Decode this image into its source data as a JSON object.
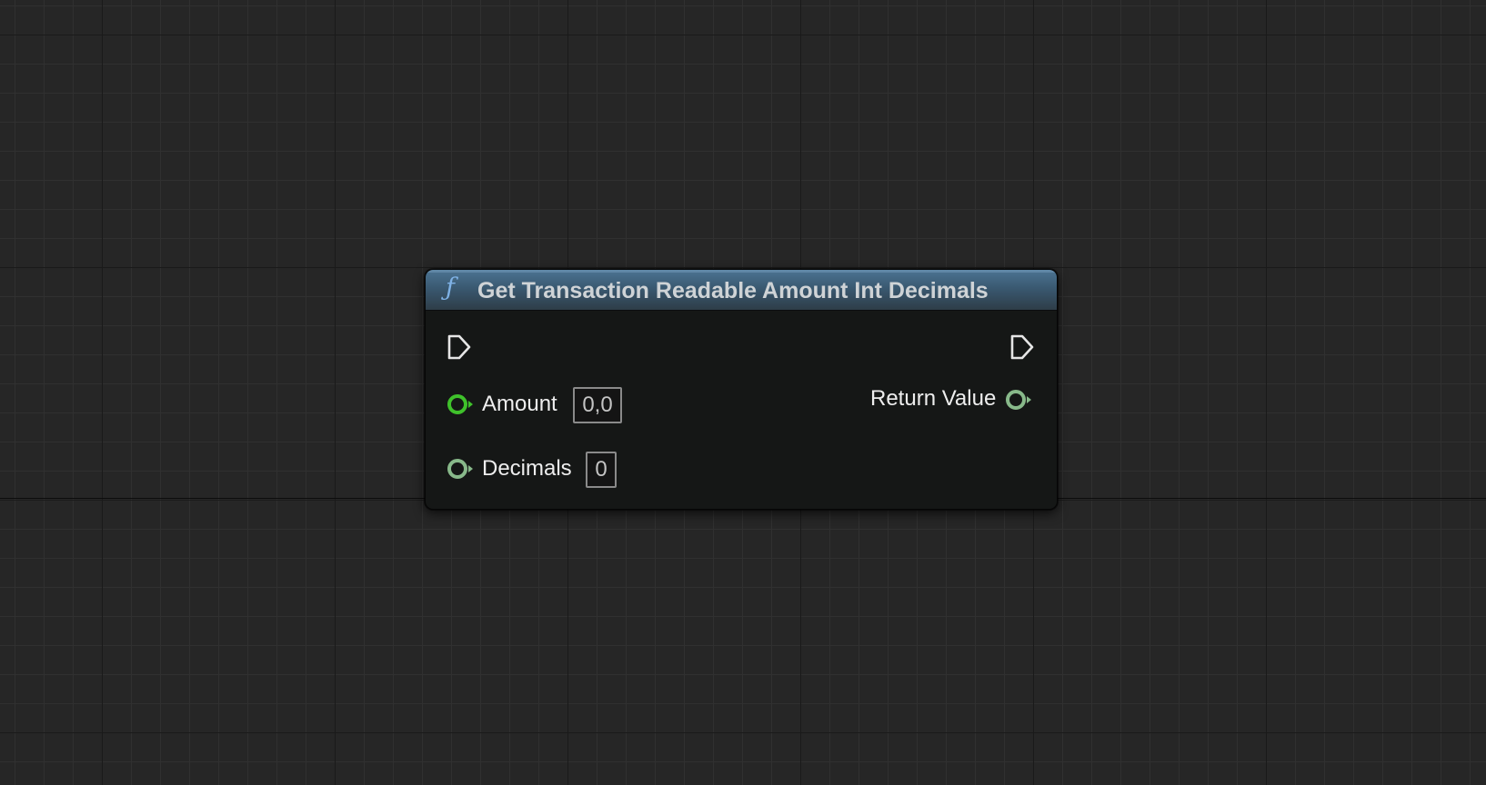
{
  "node": {
    "title": "Get Transaction Readable Amount Int Decimals",
    "icon": "function-icon",
    "header_color": "#3a5971",
    "inputs": [
      {
        "label": "Amount",
        "value": "0,0",
        "pin_color": "#3fc12b"
      },
      {
        "label": "Decimals",
        "value": "0",
        "pin_color": "#88b98a"
      }
    ],
    "outputs": [
      {
        "label": "Return Value",
        "pin_color": "#88b98a"
      }
    ]
  }
}
